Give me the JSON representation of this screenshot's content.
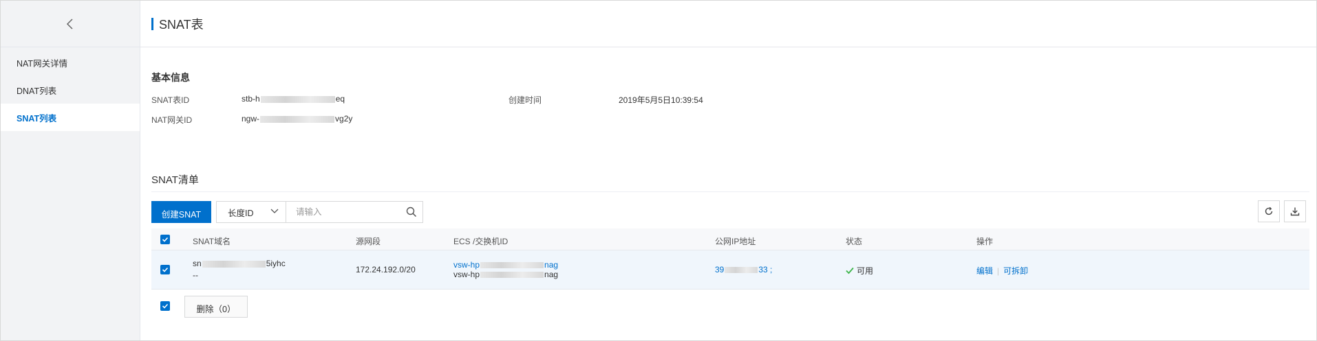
{
  "sidebar": {
    "items": [
      {
        "label": "NAT网关详情",
        "active": false
      },
      {
        "label": "DNAT列表",
        "active": false
      },
      {
        "label": "SNAT列表",
        "active": true
      }
    ]
  },
  "header": {
    "title": "SNAT表"
  },
  "basic_info": {
    "title": "基本信息",
    "snat_table_id_label": "SNAT表ID",
    "snat_table_id_prefix": "stb-h",
    "snat_table_id_suffix": "eq",
    "created_label": "创建时间",
    "created_value": "2019年5月5日10:39:54",
    "nat_gateway_id_label": "NAT网关ID",
    "nat_gateway_id_prefix": "ngw-",
    "nat_gateway_id_suffix": "vg2y"
  },
  "list": {
    "title": "SNAT清单",
    "create_button": "创建SNAT",
    "filter_select": "长度ID",
    "search_placeholder": "请输入",
    "columns": [
      "SNAT域名",
      "源网段",
      "ECS /交换机ID",
      "公网IP地址",
      "状态",
      "操作"
    ],
    "rows": [
      {
        "name_prefix": "sn",
        "name_suffix": "5iyhc",
        "name_sub": "--",
        "source_cidr": "172.24.192.0/20",
        "ecs_1_prefix": "vsw-hp",
        "ecs_1_suffix": "nag",
        "ecs_2_prefix": "vsw-hp",
        "ecs_2_suffix": "nag",
        "public_ip_prefix": "39",
        "public_ip_suffix": "33 ;",
        "status": "可用",
        "action_edit": "编辑",
        "action_detach": "可拆卸"
      }
    ],
    "delete_button": "删除（0）"
  },
  "colors": {
    "accent": "#0070cc",
    "status_ok": "#3db54a"
  }
}
